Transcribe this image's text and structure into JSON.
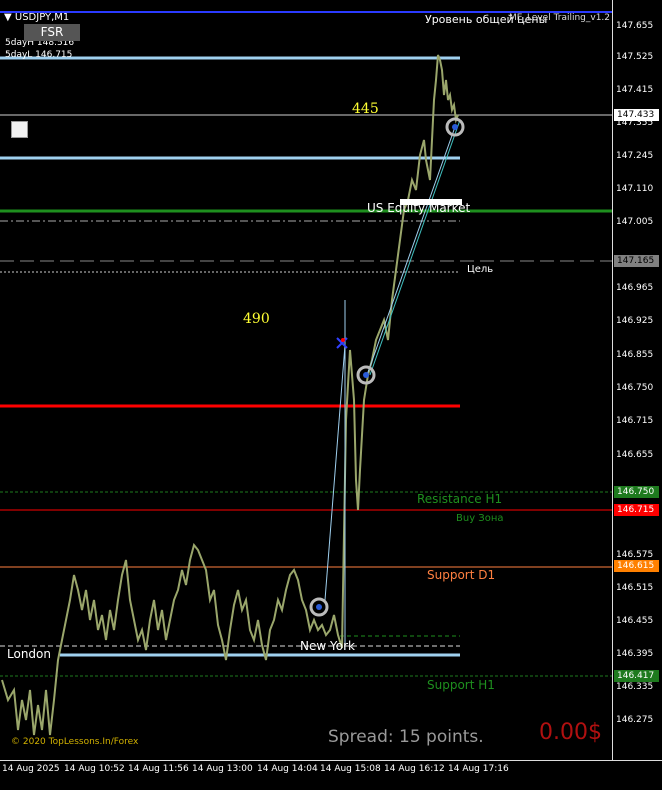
{
  "header": {
    "symbol": "USDJPY,M1",
    "indicator_title": "Уровень общей цены",
    "ea_title": "ME_Level Trailing_v1.2",
    "five_day_high": "5dayH 148.516",
    "five_day_low": "5dayL 146.715",
    "fsr_button": "FSR"
  },
  "annotations": {
    "pips_upper": "445",
    "pips_lower": "490",
    "us_equity_market": "US Equity Market",
    "target": "Цель",
    "resistance_h1": "Resistance H1",
    "buy_zone": "Buy Зона",
    "support_d1": "Support D1",
    "support_h1": "Support H1",
    "london": "London",
    "new_york": "New York",
    "copyright": "© 2020 TopLessons.In/Forex",
    "spread": "Spread: 15 points.",
    "profit": "0.00$"
  },
  "price_axis": {
    "ticks": [
      "147.655",
      "147.525",
      "147.415",
      "147.355",
      "147.245",
      "147.110",
      "147.005",
      "146.965",
      "146.925",
      "146.855",
      "146.750",
      "146.715",
      "146.655",
      "146.575",
      "146.515",
      "146.455",
      "146.395",
      "146.335",
      "146.275"
    ],
    "tags": [
      {
        "text": "147.433",
        "bg": "#ffffff",
        "fg": "#000000"
      },
      {
        "text": "147.165",
        "bg": "#808080",
        "fg": "#000000"
      },
      {
        "text": "146.750",
        "bg": "#1e7a1e",
        "fg": "#ffffff"
      },
      {
        "text": "146.715",
        "bg": "#ff0000",
        "fg": "#ffffff"
      },
      {
        "text": "146.615",
        "bg": "#ff8000",
        "fg": "#ffffff"
      },
      {
        "text": "146.417",
        "bg": "#1e7a1e",
        "fg": "#ffffff"
      }
    ]
  },
  "time_axis": {
    "ticks": [
      "14 Aug 2025",
      "14 Aug 10:52",
      "14 Aug 11:56",
      "14 Aug 13:00",
      "14 Aug 14:04",
      "14 Aug 15:08",
      "14 Aug 16:12",
      "14 Aug 17:16"
    ]
  },
  "colors": {
    "candles": "#9aa66b",
    "light_blue": "#9fd0ef",
    "red": "#ff0000",
    "green": "#1e8f1e",
    "orange": "#ff8040",
    "yellow": "#ffff33",
    "gray_text": "#9a9a9a",
    "dark_red": "#b01010"
  }
}
